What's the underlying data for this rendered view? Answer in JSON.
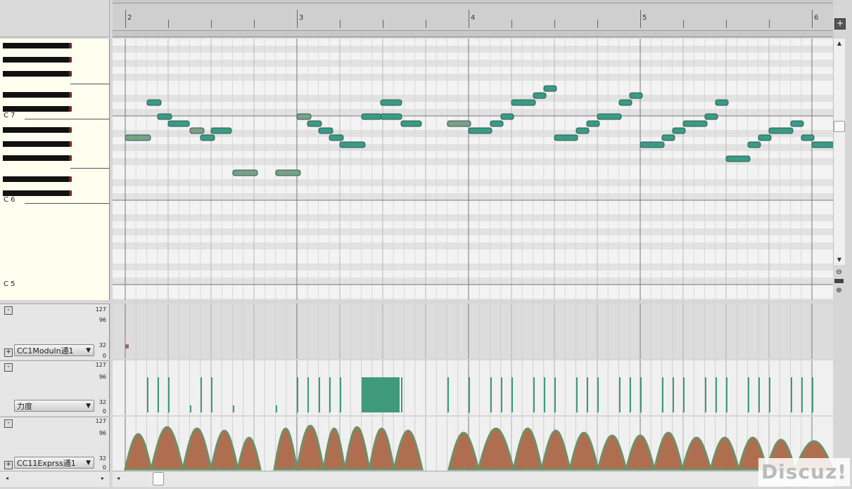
{
  "ruler": {
    "labels": [
      "2",
      "3",
      "4",
      "5",
      "6"
    ]
  },
  "keyboard": {
    "octave_labels": [
      "C 7",
      "C 6",
      "C 5"
    ]
  },
  "toolbar": {
    "add_track_label": "+"
  },
  "lanes": [
    {
      "name": "CC1Moduln通1",
      "scale_top": "127",
      "scale_mid": "96",
      "scale_low": "32",
      "scale_bottom": "0",
      "collapse_label": "-",
      "expand_label": "+",
      "dropdown_arrow": "▼"
    },
    {
      "name": "力度",
      "scale_top": "127",
      "scale_mid": "96",
      "scale_low": "32",
      "scale_bottom": "0",
      "collapse_label": "-",
      "expand_label": "+",
      "dropdown_arrow": "▼"
    },
    {
      "name": "CC11Exprss通1",
      "scale_top": "127",
      "scale_mid": "96",
      "scale_low": "32",
      "scale_bottom": "0",
      "collapse_label": "-",
      "expand_label": "+",
      "dropdown_arrow": "▼"
    }
  ],
  "zoom": {
    "zoom_out_icon": "zoom-out-icon",
    "zoom_in_icon": "zoom-in-icon"
  },
  "watermark": "Discuz!",
  "colors": {
    "note": "#3a9a86",
    "note_muted": "#7aa085",
    "velocity": "#3e9a7a",
    "expression_fill": "#b06e50",
    "expression_edge": "#6f8f68"
  }
}
